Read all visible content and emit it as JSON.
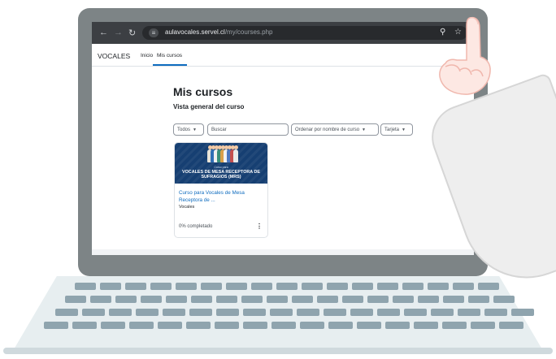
{
  "browser": {
    "url_domain": "aulavocales.servel.cl",
    "url_path": "/my/courses.php",
    "icons": [
      "back-arrow-icon",
      "forward-arrow-icon",
      "reload-icon",
      "tune-icon",
      "zoom-icon",
      "star-icon"
    ]
  },
  "site": {
    "brand": "VOCALES",
    "nav": [
      {
        "label": "Inicio"
      },
      {
        "label": "Mis cursos"
      }
    ]
  },
  "page": {
    "title": "Mis cursos",
    "subtitle": "Vista general del curso"
  },
  "filters": {
    "grouping": "Todos",
    "search_placeholder": "Buscar",
    "sort": "Ordenar por nombre de curso",
    "view": "Tarjeta"
  },
  "courses": [
    {
      "image_kicker": "Curso para",
      "image_title_line1": "VOCALES DE MESA RECEPTORA DE",
      "image_title_line2": "SUFRAGIOS (MRS)",
      "name_line1": "Curso para Vocales de Mesa",
      "name_line2": "Receptora de ...",
      "category": "Vocales",
      "progress_text": "0% completado",
      "progress": 0
    }
  ],
  "colors": {
    "accent": "#0f6cbf",
    "chrome": "#3c3f43",
    "course_image_bg": "#163f72",
    "laptop": "#7d8486"
  }
}
